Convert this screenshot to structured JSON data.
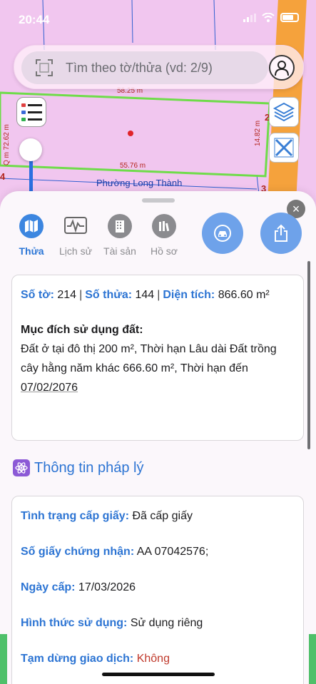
{
  "status": {
    "time": "20:44"
  },
  "search": {
    "placeholder": "Tìm theo tờ/thửa (vd: 2/9)"
  },
  "map": {
    "dim_top": "58.25 m",
    "dim_bottom": "55.76 m",
    "dim_right": "14.82 m",
    "dim_left": "Q m 72.62 m",
    "ward": "Phường Long Thành",
    "corner_2": "2",
    "corner_3": "3",
    "corner_4": "4"
  },
  "tabs": [
    {
      "label": "Thửa",
      "icon": "map-icon"
    },
    {
      "label": "Lịch sử",
      "icon": "history-chart-icon"
    },
    {
      "label": "Tài sản",
      "icon": "building-icon"
    },
    {
      "label": "Hồ sơ",
      "icon": "books-icon"
    }
  ],
  "parcel": {
    "so_to_label": "Số tờ:",
    "so_to": "214",
    "so_thua_label": "Số thửa:",
    "so_thua": "144",
    "dien_tich_label": "Diện tích:",
    "dien_tich": "866.60 m²",
    "muc_dich_label": "Mục đích sử dụng đất:",
    "muc_dich_1": "Đất ở tại đô thị 200 m², Thời hạn Lâu dài Đất trồng cây hằng năm khác 666.60 m², Thời hạn đến ",
    "muc_dich_date": "07/02/2076"
  },
  "legal": {
    "title": "Thông tin pháp lý",
    "tinh_trang_label": "Tình trạng cấp giấy:",
    "tinh_trang": "Đã cấp giấy",
    "so_giay_label": "Số giấy chứng nhận:",
    "so_giay": "AA 07042576;",
    "ngay_cap_label": "Ngày cấp:",
    "ngay_cap": "17/03/2026",
    "hinh_thuc_label": "Hình thức sử dụng:",
    "hinh_thuc": "Sử dụng riêng",
    "tam_dung_label": "Tạm dừng giao dịch:",
    "tam_dung": "Không"
  },
  "colors": {
    "accent": "#2c74d3",
    "parcel_border": "#6fdc4a",
    "road": "#f5a23c"
  }
}
